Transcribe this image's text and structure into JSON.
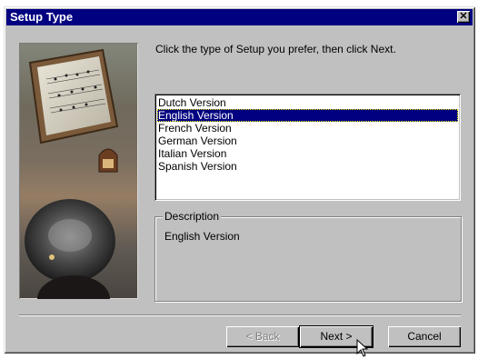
{
  "window": {
    "title": "Setup Type",
    "close_glyph": "✕"
  },
  "prompt": "Click the type of Setup you prefer, then click Next.",
  "versions": {
    "items": [
      "Dutch Version",
      "English Version",
      "French Version",
      "German Version",
      "Italian Version",
      "Spanish Version"
    ],
    "selected": "English Version"
  },
  "description": {
    "legend": "Description",
    "text": "English Version"
  },
  "buttons": {
    "back": "< Back",
    "next": "Next >",
    "cancel": "Cancel"
  },
  "colors": {
    "titlebar": "#000080",
    "face": "#c0c0c0",
    "selection": "#000080"
  }
}
